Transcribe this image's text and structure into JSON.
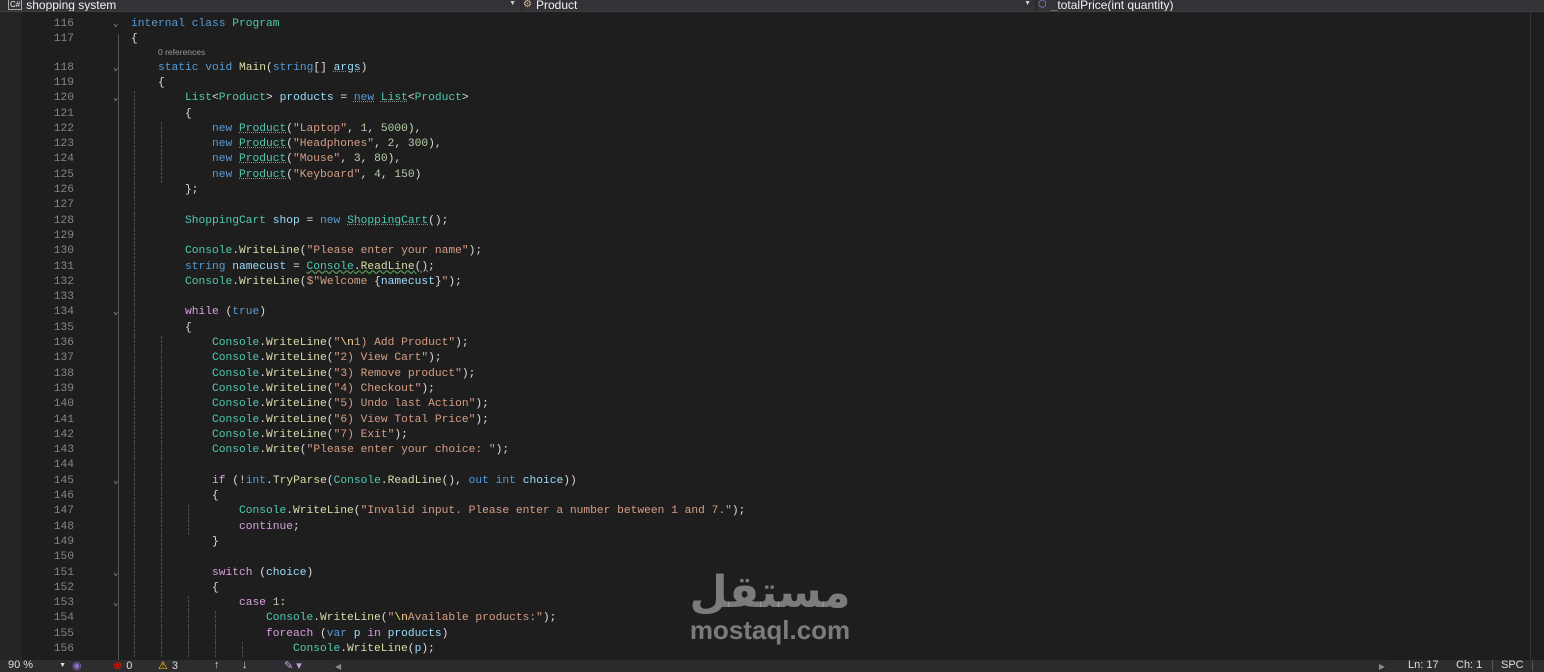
{
  "navbar": {
    "project": "shopping system",
    "type": "Product",
    "member": "_totalPrice(int quantity)"
  },
  "codelens": "0 references",
  "status": {
    "zoom": "90 %",
    "errors": "0",
    "warnings": "3",
    "line": "Ln: 17",
    "col": "Ch: 1",
    "encoding": "SPC"
  },
  "watermark": {
    "arabic": "مستقل",
    "latin": "mostaql.com"
  },
  "lines": [
    {
      "n": "116",
      "i": 0,
      "f": 1,
      "t": [
        [
          "kw",
          "internal "
        ],
        [
          "kw",
          "class "
        ],
        [
          "ty",
          "Program"
        ]
      ]
    },
    {
      "n": "117",
      "i": 0,
      "t": [
        [
          "pu",
          "{"
        ]
      ]
    },
    {
      "n": "118",
      "i": 1,
      "f": 1,
      "lens": 1,
      "t": [
        [
          "kw",
          "static "
        ],
        [
          "kw",
          "void "
        ],
        [
          "me",
          "Main"
        ],
        [
          "pu",
          "("
        ],
        [
          "kw",
          "string"
        ],
        [
          "pu",
          "[] "
        ],
        [
          "va sq",
          "args"
        ],
        [
          "pu",
          ")"
        ]
      ]
    },
    {
      "n": "119",
      "i": 1,
      "t": [
        [
          "pu",
          "{"
        ]
      ]
    },
    {
      "n": "120",
      "i": 2,
      "f": 1,
      "t": [
        [
          "ty",
          "List"
        ],
        [
          "pu",
          "<"
        ],
        [
          "ty",
          "Product"
        ],
        [
          "pu",
          "> "
        ],
        [
          "va",
          "products"
        ],
        [
          "pu",
          " = "
        ],
        [
          "kw sq",
          "new"
        ],
        [
          "pu",
          " "
        ],
        [
          "ty sq",
          "List"
        ],
        [
          "pu",
          "<"
        ],
        [
          "ty",
          "Product"
        ],
        [
          "pu",
          ">"
        ]
      ]
    },
    {
      "n": "121",
      "i": 2,
      "t": [
        [
          "pu",
          "{"
        ]
      ]
    },
    {
      "n": "122",
      "i": 3,
      "t": [
        [
          "kw",
          "new "
        ],
        [
          "ty sq",
          "Product"
        ],
        [
          "pu",
          "("
        ],
        [
          "st",
          "\"Laptop\""
        ],
        [
          "pu",
          ", "
        ],
        [
          "nu",
          "1"
        ],
        [
          "pu",
          ", "
        ],
        [
          "nu",
          "5000"
        ],
        [
          "pu",
          "),"
        ]
      ]
    },
    {
      "n": "123",
      "i": 3,
      "t": [
        [
          "kw",
          "new "
        ],
        [
          "ty sq",
          "Product"
        ],
        [
          "pu",
          "("
        ],
        [
          "st",
          "\"Headphones\""
        ],
        [
          "pu",
          ", "
        ],
        [
          "nu",
          "2"
        ],
        [
          "pu",
          ", "
        ],
        [
          "nu",
          "300"
        ],
        [
          "pu",
          "),"
        ]
      ]
    },
    {
      "n": "124",
      "i": 3,
      "t": [
        [
          "kw",
          "new "
        ],
        [
          "ty sq",
          "Product"
        ],
        [
          "pu",
          "("
        ],
        [
          "st",
          "\"Mouse\""
        ],
        [
          "pu",
          ", "
        ],
        [
          "nu",
          "3"
        ],
        [
          "pu",
          ", "
        ],
        [
          "nu",
          "80"
        ],
        [
          "pu",
          "),"
        ]
      ]
    },
    {
      "n": "125",
      "i": 3,
      "t": [
        [
          "kw",
          "new "
        ],
        [
          "ty sq",
          "Product"
        ],
        [
          "pu",
          "("
        ],
        [
          "st",
          "\"Keyboard\""
        ],
        [
          "pu",
          ", "
        ],
        [
          "nu",
          "4"
        ],
        [
          "pu",
          ", "
        ],
        [
          "nu",
          "150"
        ],
        [
          "pu",
          ")"
        ]
      ]
    },
    {
      "n": "126",
      "i": 2,
      "t": [
        [
          "pu",
          "};"
        ]
      ]
    },
    {
      "n": "127",
      "i": 2,
      "t": []
    },
    {
      "n": "128",
      "i": 2,
      "t": [
        [
          "ty",
          "ShoppingCart "
        ],
        [
          "va",
          "shop"
        ],
        [
          "pu",
          " = "
        ],
        [
          "kw",
          "new "
        ],
        [
          "ty sq",
          "ShoppingCart"
        ],
        [
          "pu",
          "();"
        ]
      ]
    },
    {
      "n": "129",
      "i": 2,
      "t": []
    },
    {
      "n": "130",
      "i": 2,
      "t": [
        [
          "ty",
          "Console"
        ],
        [
          "pu",
          "."
        ],
        [
          "me",
          "WriteLine"
        ],
        [
          "pu",
          "("
        ],
        [
          "st",
          "\"Please enter your name\""
        ],
        [
          "pu",
          ");"
        ]
      ]
    },
    {
      "n": "131",
      "i": 2,
      "t": [
        [
          "kw",
          "string "
        ],
        [
          "va",
          "namecust"
        ],
        [
          "pu",
          " = "
        ],
        [
          "ty wv",
          "Console"
        ],
        [
          "pu wv",
          "."
        ],
        [
          "me wv",
          "ReadLine"
        ],
        [
          "pu wv",
          "()"
        ],
        [
          "pu",
          ";"
        ]
      ]
    },
    {
      "n": "132",
      "i": 2,
      "t": [
        [
          "ty",
          "Console"
        ],
        [
          "pu",
          "."
        ],
        [
          "me",
          "WriteLine"
        ],
        [
          "pu",
          "("
        ],
        [
          "st",
          "$\"Welcome "
        ],
        [
          "pu",
          "{"
        ],
        [
          "va",
          "namecust"
        ],
        [
          "pu",
          "}"
        ],
        [
          "st",
          "\""
        ],
        [
          "pu",
          ");"
        ]
      ]
    },
    {
      "n": "133",
      "i": 2,
      "t": []
    },
    {
      "n": "134",
      "i": 2,
      "f": 1,
      "t": [
        [
          "ctl",
          "while "
        ],
        [
          "pu",
          "("
        ],
        [
          "kw",
          "true"
        ],
        [
          "pu",
          ")"
        ]
      ]
    },
    {
      "n": "135",
      "i": 2,
      "t": [
        [
          "pu",
          "{"
        ]
      ]
    },
    {
      "n": "136",
      "i": 3,
      "t": [
        [
          "ty",
          "Console"
        ],
        [
          "pu",
          "."
        ],
        [
          "me",
          "WriteLine"
        ],
        [
          "pu",
          "("
        ],
        [
          "st",
          "\""
        ],
        [
          "es",
          "\\n"
        ],
        [
          "st",
          "1) Add Product\""
        ],
        [
          "pu",
          ");"
        ]
      ]
    },
    {
      "n": "137",
      "i": 3,
      "t": [
        [
          "ty",
          "Console"
        ],
        [
          "pu",
          "."
        ],
        [
          "me",
          "WriteLine"
        ],
        [
          "pu",
          "("
        ],
        [
          "st",
          "\"2) View Cart\""
        ],
        [
          "pu",
          ");"
        ]
      ]
    },
    {
      "n": "138",
      "i": 3,
      "t": [
        [
          "ty",
          "Console"
        ],
        [
          "pu",
          "."
        ],
        [
          "me",
          "WriteLine"
        ],
        [
          "pu",
          "("
        ],
        [
          "st",
          "\"3) Remove product\""
        ],
        [
          "pu",
          ");"
        ]
      ]
    },
    {
      "n": "139",
      "i": 3,
      "t": [
        [
          "ty",
          "Console"
        ],
        [
          "pu",
          "."
        ],
        [
          "me",
          "WriteLine"
        ],
        [
          "pu",
          "("
        ],
        [
          "st",
          "\"4) Checkout\""
        ],
        [
          "pu",
          ");"
        ]
      ]
    },
    {
      "n": "140",
      "i": 3,
      "t": [
        [
          "ty",
          "Console"
        ],
        [
          "pu",
          "."
        ],
        [
          "me",
          "WriteLine"
        ],
        [
          "pu",
          "("
        ],
        [
          "st",
          "\"5) Undo last Action\""
        ],
        [
          "pu",
          ");"
        ]
      ]
    },
    {
      "n": "141",
      "i": 3,
      "t": [
        [
          "ty",
          "Console"
        ],
        [
          "pu",
          "."
        ],
        [
          "me",
          "WriteLine"
        ],
        [
          "pu",
          "("
        ],
        [
          "st",
          "\"6) View Total Price\""
        ],
        [
          "pu",
          ");"
        ]
      ]
    },
    {
      "n": "142",
      "i": 3,
      "t": [
        [
          "ty",
          "Console"
        ],
        [
          "pu",
          "."
        ],
        [
          "me",
          "WriteLine"
        ],
        [
          "pu",
          "("
        ],
        [
          "st",
          "\"7) Exit\""
        ],
        [
          "pu",
          ");"
        ]
      ]
    },
    {
      "n": "143",
      "i": 3,
      "t": [
        [
          "ty",
          "Console"
        ],
        [
          "pu",
          "."
        ],
        [
          "me",
          "Write"
        ],
        [
          "pu",
          "("
        ],
        [
          "st",
          "\"Please enter your choice: \""
        ],
        [
          "pu",
          ");"
        ]
      ]
    },
    {
      "n": "144",
      "i": 3,
      "t": []
    },
    {
      "n": "145",
      "i": 3,
      "f": 1,
      "t": [
        [
          "ctl",
          "if "
        ],
        [
          "pu",
          "(!"
        ],
        [
          "kw",
          "int"
        ],
        [
          "pu",
          "."
        ],
        [
          "me",
          "TryParse"
        ],
        [
          "pu",
          "("
        ],
        [
          "ty",
          "Console"
        ],
        [
          "pu",
          "."
        ],
        [
          "me",
          "ReadLine"
        ],
        [
          "pu",
          "(), "
        ],
        [
          "kw",
          "out "
        ],
        [
          "kw",
          "int "
        ],
        [
          "va",
          "choice"
        ],
        [
          "pu",
          "))"
        ]
      ]
    },
    {
      "n": "146",
      "i": 3,
      "t": [
        [
          "pu",
          "{"
        ]
      ]
    },
    {
      "n": "147",
      "i": 4,
      "t": [
        [
          "ty",
          "Console"
        ],
        [
          "pu",
          "."
        ],
        [
          "me",
          "WriteLine"
        ],
        [
          "pu",
          "("
        ],
        [
          "st",
          "\"Invalid input. Please enter a number between 1 and 7.\""
        ],
        [
          "pu",
          ");"
        ]
      ]
    },
    {
      "n": "148",
      "i": 4,
      "t": [
        [
          "ctl",
          "continue"
        ],
        [
          "pu",
          ";"
        ]
      ]
    },
    {
      "n": "149",
      "i": 3,
      "t": [
        [
          "pu",
          "}"
        ]
      ]
    },
    {
      "n": "150",
      "i": 3,
      "t": []
    },
    {
      "n": "151",
      "i": 3,
      "f": 1,
      "t": [
        [
          "ctl",
          "switch "
        ],
        [
          "pu",
          "("
        ],
        [
          "va",
          "choice"
        ],
        [
          "pu",
          ")"
        ]
      ]
    },
    {
      "n": "152",
      "i": 3,
      "t": [
        [
          "pu",
          "{"
        ]
      ]
    },
    {
      "n": "153",
      "i": 4,
      "f": 1,
      "t": [
        [
          "ctl",
          "case "
        ],
        [
          "nu",
          "1"
        ],
        [
          "pu",
          ":"
        ]
      ]
    },
    {
      "n": "154",
      "i": 5,
      "t": [
        [
          "ty",
          "Console"
        ],
        [
          "pu",
          "."
        ],
        [
          "me",
          "WriteLine"
        ],
        [
          "pu",
          "("
        ],
        [
          "st",
          "\""
        ],
        [
          "es",
          "\\n"
        ],
        [
          "st",
          "Available products:\""
        ],
        [
          "pu",
          ");"
        ]
      ]
    },
    {
      "n": "155",
      "i": 5,
      "t": [
        [
          "ctl",
          "foreach "
        ],
        [
          "pu",
          "("
        ],
        [
          "kw",
          "var "
        ],
        [
          "va",
          "p "
        ],
        [
          "ctl",
          "in "
        ],
        [
          "va",
          "products"
        ],
        [
          "pu",
          ")"
        ]
      ]
    },
    {
      "n": "156",
      "i": 6,
      "t": [
        [
          "ty",
          "Console"
        ],
        [
          "pu",
          "."
        ],
        [
          "me",
          "WriteLine"
        ],
        [
          "pu",
          "("
        ],
        [
          "va",
          "p"
        ],
        [
          "pu",
          ");"
        ]
      ]
    }
  ]
}
